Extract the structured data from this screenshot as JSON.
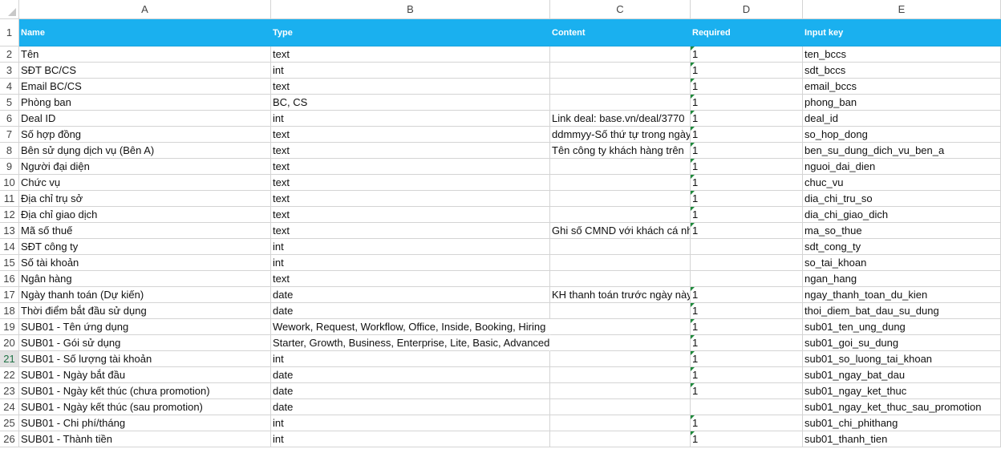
{
  "columns": [
    "A",
    "B",
    "C",
    "D",
    "E"
  ],
  "header": {
    "num": "1",
    "cells": [
      "Name",
      "Type",
      "Content",
      "Required",
      "Input key"
    ]
  },
  "active_row": "21",
  "rows": [
    {
      "num": "2",
      "a": "Tên",
      "b": "text",
      "c": "",
      "d": "1",
      "e": "ten_bccs"
    },
    {
      "num": "3",
      "a": "SĐT BC/CS",
      "b": "int",
      "c": "",
      "d": "1",
      "e": "sdt_bccs"
    },
    {
      "num": "4",
      "a": "Email BC/CS",
      "b": "text",
      "c": "",
      "d": "1",
      "e": "email_bccs"
    },
    {
      "num": "5",
      "a": "Phòng ban",
      "b": "BC, CS",
      "c": "",
      "d": "1",
      "e": "phong_ban"
    },
    {
      "num": "6",
      "a": "Deal ID",
      "b": "int",
      "c": "Link deal: base.vn/deal/3770",
      "d": "1",
      "e": "deal_id"
    },
    {
      "num": "7",
      "a": "Số hợp đồng",
      "b": "text",
      "c": "ddmmyy-Số thứ tự trong ngày",
      "d": "1",
      "e": "so_hop_dong"
    },
    {
      "num": "8",
      "a": "Bên sử dụng dịch vụ (Bên A)",
      "b": "text",
      "c": "Tên công ty khách hàng trên",
      "d": "1",
      "e": "ben_su_dung_dich_vu_ben_a"
    },
    {
      "num": "9",
      "a": "Người đại diện",
      "b": "text",
      "c": "",
      "d": "1",
      "e": "nguoi_dai_dien"
    },
    {
      "num": "10",
      "a": "Chức vụ",
      "b": "text",
      "c": "",
      "d": "1",
      "e": "chuc_vu"
    },
    {
      "num": "11",
      "a": "Địa chỉ trụ sở",
      "b": "text",
      "c": "",
      "d": "1",
      "e": "dia_chi_tru_so"
    },
    {
      "num": "12",
      "a": "Địa chỉ giao dịch",
      "b": "text",
      "c": "",
      "d": "1",
      "e": "dia_chi_giao_dich"
    },
    {
      "num": "13",
      "a": "Mã số thuế",
      "b": "text",
      "c": "Ghi số CMND với khách cá nhân",
      "d": "1",
      "e": "ma_so_thue"
    },
    {
      "num": "14",
      "a": "SĐT công ty",
      "b": "int",
      "c": "",
      "d": "",
      "e": "sdt_cong_ty"
    },
    {
      "num": "15",
      "a": "Số tài khoản",
      "b": "int",
      "c": "",
      "d": "",
      "e": "so_tai_khoan"
    },
    {
      "num": "16",
      "a": "Ngân hàng",
      "b": "text",
      "c": "",
      "d": "",
      "e": "ngan_hang"
    },
    {
      "num": "17",
      "a": "Ngày thanh toán (Dự kiến)",
      "b": "date",
      "c": "KH thanh toán trước ngày này",
      "d": "1",
      "e": "ngay_thanh_toan_du_kien"
    },
    {
      "num": "18",
      "a": "Thời điểm bắt đầu sử dụng",
      "b": "date",
      "c": "",
      "d": "1",
      "e": "thoi_diem_bat_dau_su_dung"
    },
    {
      "num": "19",
      "a": "SUB01 - Tên ứng dụng",
      "b": "Wework, Request, Workflow, Office, Inside, Booking, Hiring",
      "c": "",
      "d": "1",
      "e": "sub01_ten_ung_dung",
      "spill": true
    },
    {
      "num": "20",
      "a": "SUB01 - Gói sử dụng",
      "b": "Starter, Growth, Business, Enterprise, Lite, Basic, Advanced",
      "c": "",
      "d": "1",
      "e": "sub01_goi_su_dung",
      "spill": true
    },
    {
      "num": "21",
      "a": "SUB01 - Số lượng tài khoản",
      "b": "int",
      "c": "",
      "d": "1",
      "e": "sub01_so_luong_tai_khoan"
    },
    {
      "num": "22",
      "a": "SUB01 - Ngày bắt đầu",
      "b": "date",
      "c": "",
      "d": "1",
      "e": "sub01_ngay_bat_dau"
    },
    {
      "num": "23",
      "a": "SUB01 - Ngày kết thúc (chưa promotion)",
      "b": "date",
      "c": "",
      "d": "1",
      "e": "sub01_ngay_ket_thuc"
    },
    {
      "num": "24",
      "a": "SUB01 - Ngày kết thúc (sau promotion)",
      "b": "date",
      "c": "",
      "d": "",
      "e": "sub01_ngay_ket_thuc_sau_promotion"
    },
    {
      "num": "25",
      "a": "SUB01 - Chi phí/tháng",
      "b": "int",
      "c": "",
      "d": "1",
      "e": "sub01_chi_phithang"
    },
    {
      "num": "26",
      "a": "SUB01 - Thành tiền",
      "b": "int",
      "c": "",
      "d": "1",
      "e": "sub01_thanh_tien"
    }
  ]
}
